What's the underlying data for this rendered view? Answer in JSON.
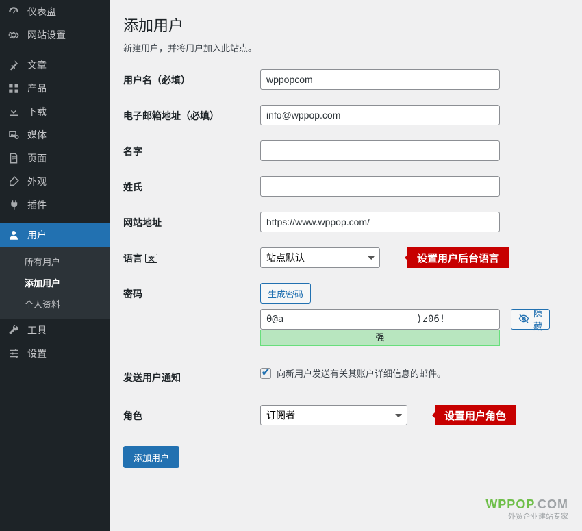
{
  "sidebar": {
    "items": [
      {
        "id": "dashboard",
        "label": "仪表盘",
        "icon": "gauge-icon"
      },
      {
        "id": "site-settings",
        "label": "网站设置",
        "icon": "gear-icon"
      },
      {
        "id": "posts",
        "label": "文章",
        "icon": "pin-icon"
      },
      {
        "id": "products",
        "label": "产品",
        "icon": "grid-icon"
      },
      {
        "id": "downloads",
        "label": "下载",
        "icon": "download-icon"
      },
      {
        "id": "media",
        "label": "媒体",
        "icon": "media-icon"
      },
      {
        "id": "pages",
        "label": "页面",
        "icon": "page-icon"
      },
      {
        "id": "appearance",
        "label": "外观",
        "icon": "brush-icon"
      },
      {
        "id": "plugins",
        "label": "插件",
        "icon": "plug-icon"
      },
      {
        "id": "users",
        "label": "用户",
        "icon": "user-icon",
        "current": true,
        "submenu": [
          {
            "id": "all-users",
            "label": "所有用户"
          },
          {
            "id": "add-user",
            "label": "添加用户",
            "current": true
          },
          {
            "id": "profile",
            "label": "个人资料"
          }
        ]
      },
      {
        "id": "tools",
        "label": "工具",
        "icon": "wrench-icon"
      },
      {
        "id": "settings",
        "label": "设置",
        "icon": "sliders-icon"
      }
    ]
  },
  "page": {
    "title": "添加用户",
    "subtitle": "新建用户，并将用户加入此站点。"
  },
  "form": {
    "username": {
      "label": "用户名（必填）",
      "value": "wppopcom"
    },
    "email": {
      "label": "电子邮箱地址（必填）",
      "value": "info@wppop.com"
    },
    "first_name": {
      "label": "名字",
      "value": ""
    },
    "last_name": {
      "label": "姓氏",
      "value": ""
    },
    "website": {
      "label": "网站地址",
      "value": "https://www.wppop.com/"
    },
    "language": {
      "label": "语言",
      "selected": "站点默认",
      "callout": "设置用户后台语言"
    },
    "password": {
      "label": "密码",
      "generate_btn": "生成密码",
      "value": "0@a                       )z06!",
      "strength_text": "强",
      "hide_btn": "隐藏"
    },
    "notify": {
      "label": "发送用户通知",
      "text": "向新用户发送有关其账户详细信息的邮件。",
      "checked": true
    },
    "role": {
      "label": "角色",
      "selected": "订阅者",
      "callout": "设置用户角色"
    },
    "submit": "添加用户"
  },
  "watermark": {
    "brand_a": "WPPOP",
    "brand_b": ".COM",
    "tagline": "外贸企业建站专家"
  }
}
